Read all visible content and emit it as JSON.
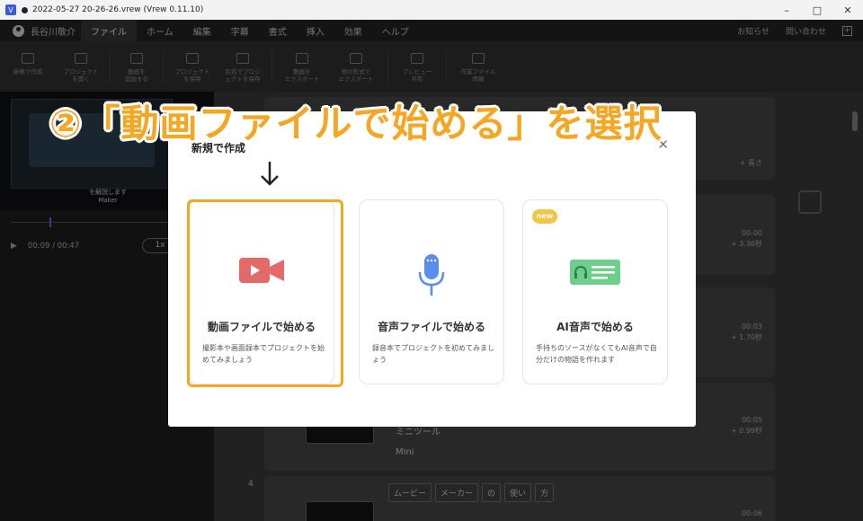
{
  "titlebar": {
    "app_icon": "V",
    "title": "2022-05-27 20-26-26.vrew (Vrew 0.11.10)",
    "min": "–",
    "max": "□",
    "close": "✕"
  },
  "menubar": {
    "user": "長谷川敬介",
    "items": [
      "ファイル",
      "ホーム",
      "編集",
      "字幕",
      "書式",
      "挿入",
      "効果",
      "ヘルプ"
    ],
    "notice": "お知らせ",
    "contact": "問い合わせ"
  },
  "ribbon": {
    "new": "新規で作成",
    "open": [
      "プロジェクト",
      "を開く"
    ],
    "add": [
      "動画を",
      "追加する"
    ],
    "save": [
      "プロジェクト",
      "を保存"
    ],
    "save_as": [
      "別名でプロジ",
      "ェクトを保存"
    ],
    "export_video": [
      "動画を",
      "エクスポート"
    ],
    "export_other": [
      "他の形式で",
      "エクスポート"
    ],
    "preview": [
      "プレビュー",
      "共有"
    ],
    "workfile": [
      "作業ファイル",
      "情報"
    ]
  },
  "preview": {
    "caption_line1": "を解説します",
    "caption_line2": "Maker",
    "time": "00:09 / 00:47",
    "speed": "1x"
  },
  "clips": [
    {
      "time": "",
      "dur": "+ 長さ",
      "label": ""
    },
    {
      "time": "00:00",
      "dur": "+ 3.36秒"
    },
    {
      "time": "00:03",
      "dur": "+ 1.70秒"
    },
    {
      "time": "00:05",
      "dur": "+ 0.99秒",
      "text1": "ミニツール",
      "text2": "Mini"
    },
    {
      "no": "4",
      "time": "00:06",
      "chips": [
        "ムービー",
        "メーカー",
        "の",
        "使い",
        "方"
      ]
    }
  ],
  "dialog": {
    "title": "新規で作成",
    "close": "✕",
    "options": [
      {
        "title": "動画ファイルで始める",
        "desc": "撮影本や画面録本でプロジェクトを始めてみましょう"
      },
      {
        "title": "音声ファイルで始める",
        "desc": "録音本でプロジェクトを初めてみましょう"
      },
      {
        "title": "AI音声で始める",
        "desc": "手持ちのソースがなくてもAI音声で自分だけの物語を作れます",
        "badge": "new"
      }
    ]
  },
  "annotation": {
    "headline": "②「動画ファイルで始める」を選択",
    "arrow": "↓"
  },
  "colors": {
    "accent": "#f5a623",
    "video_icon": "#e46a6a",
    "mic_icon": "#5b8def",
    "ai_icon": "#6ccf8a",
    "badge": "#f2c644"
  }
}
